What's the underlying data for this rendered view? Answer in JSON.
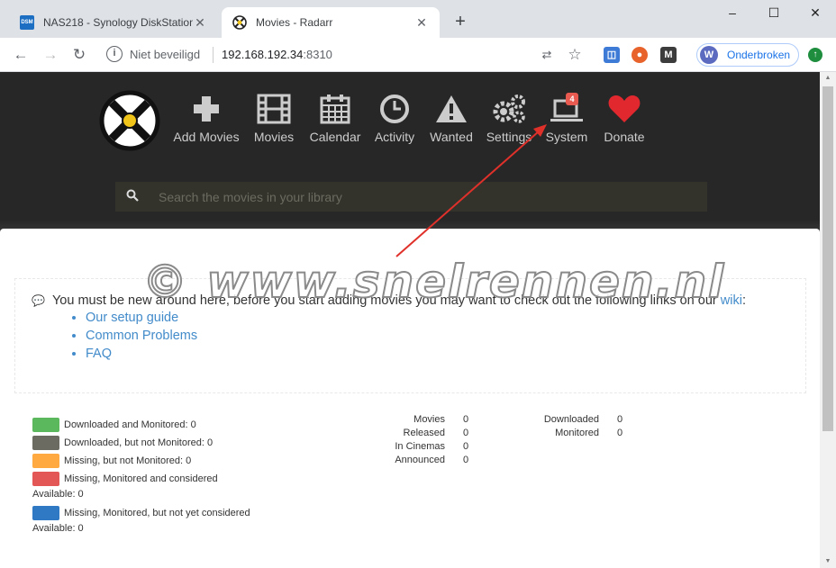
{
  "browser": {
    "tabs": [
      {
        "title": "NAS218 - Synology DiskStation",
        "favicon": "dsm-icon",
        "favicon_text": "DSM"
      },
      {
        "title": "Movies - Radarr",
        "favicon": "radarr-icon"
      }
    ],
    "address": {
      "security_label": "Niet beveiligd",
      "url_host": "192.168.192.34",
      "url_port": ":8310"
    },
    "profile": {
      "initial": "W",
      "name": "Onderbroken"
    }
  },
  "nav": {
    "items": [
      {
        "label": "Add Movies",
        "icon": "plus-icon"
      },
      {
        "label": "Movies",
        "icon": "film-icon"
      },
      {
        "label": "Calendar",
        "icon": "calendar-icon"
      },
      {
        "label": "Activity",
        "icon": "clock-icon"
      },
      {
        "label": "Wanted",
        "icon": "warning-icon"
      },
      {
        "label": "Settings",
        "icon": "gears-icon"
      },
      {
        "label": "System",
        "icon": "laptop-icon",
        "badge": "4"
      },
      {
        "label": "Donate",
        "icon": "heart-icon"
      }
    ]
  },
  "search": {
    "placeholder": "Search the movies in your library"
  },
  "welcome": {
    "message_before": "You must be new around here, before you start adding movies you may want to check out the following links on our ",
    "wiki_link": "wiki",
    "message_after": ":",
    "links": [
      "Our setup guide",
      "Common Problems",
      "FAQ"
    ]
  },
  "legend": {
    "items": [
      {
        "label": "Downloaded and Monitored: 0",
        "color": "#5cb85c"
      },
      {
        "label": "Downloaded, but not Monitored: 0",
        "color": "#6b6b61"
      },
      {
        "label": "Missing, but not Monitored: 0",
        "color": "#ffa940"
      },
      {
        "label": "Missing, Monitored and considered",
        "color": "#e35757",
        "sub": "Available: 0"
      },
      {
        "label": "Missing, Monitored, but not yet considered",
        "color": "#2f78c4",
        "sub": "Available: 0"
      }
    ]
  },
  "stats": {
    "left": [
      {
        "label": "Movies",
        "value": "0"
      },
      {
        "label": "Released",
        "value": "0"
      },
      {
        "label": "In Cinemas",
        "value": "0"
      },
      {
        "label": "Announced",
        "value": "0"
      }
    ],
    "right": [
      {
        "label": "Downloaded",
        "value": "0"
      },
      {
        "label": "Monitored",
        "value": "0"
      }
    ]
  },
  "watermark": "© www.snelrennen.nl",
  "colors": {
    "header_bg": "#272727",
    "accent_link": "#428bca",
    "heart": "#e0282e",
    "badge": "#e85a4f",
    "arrow": "#e0302a"
  }
}
